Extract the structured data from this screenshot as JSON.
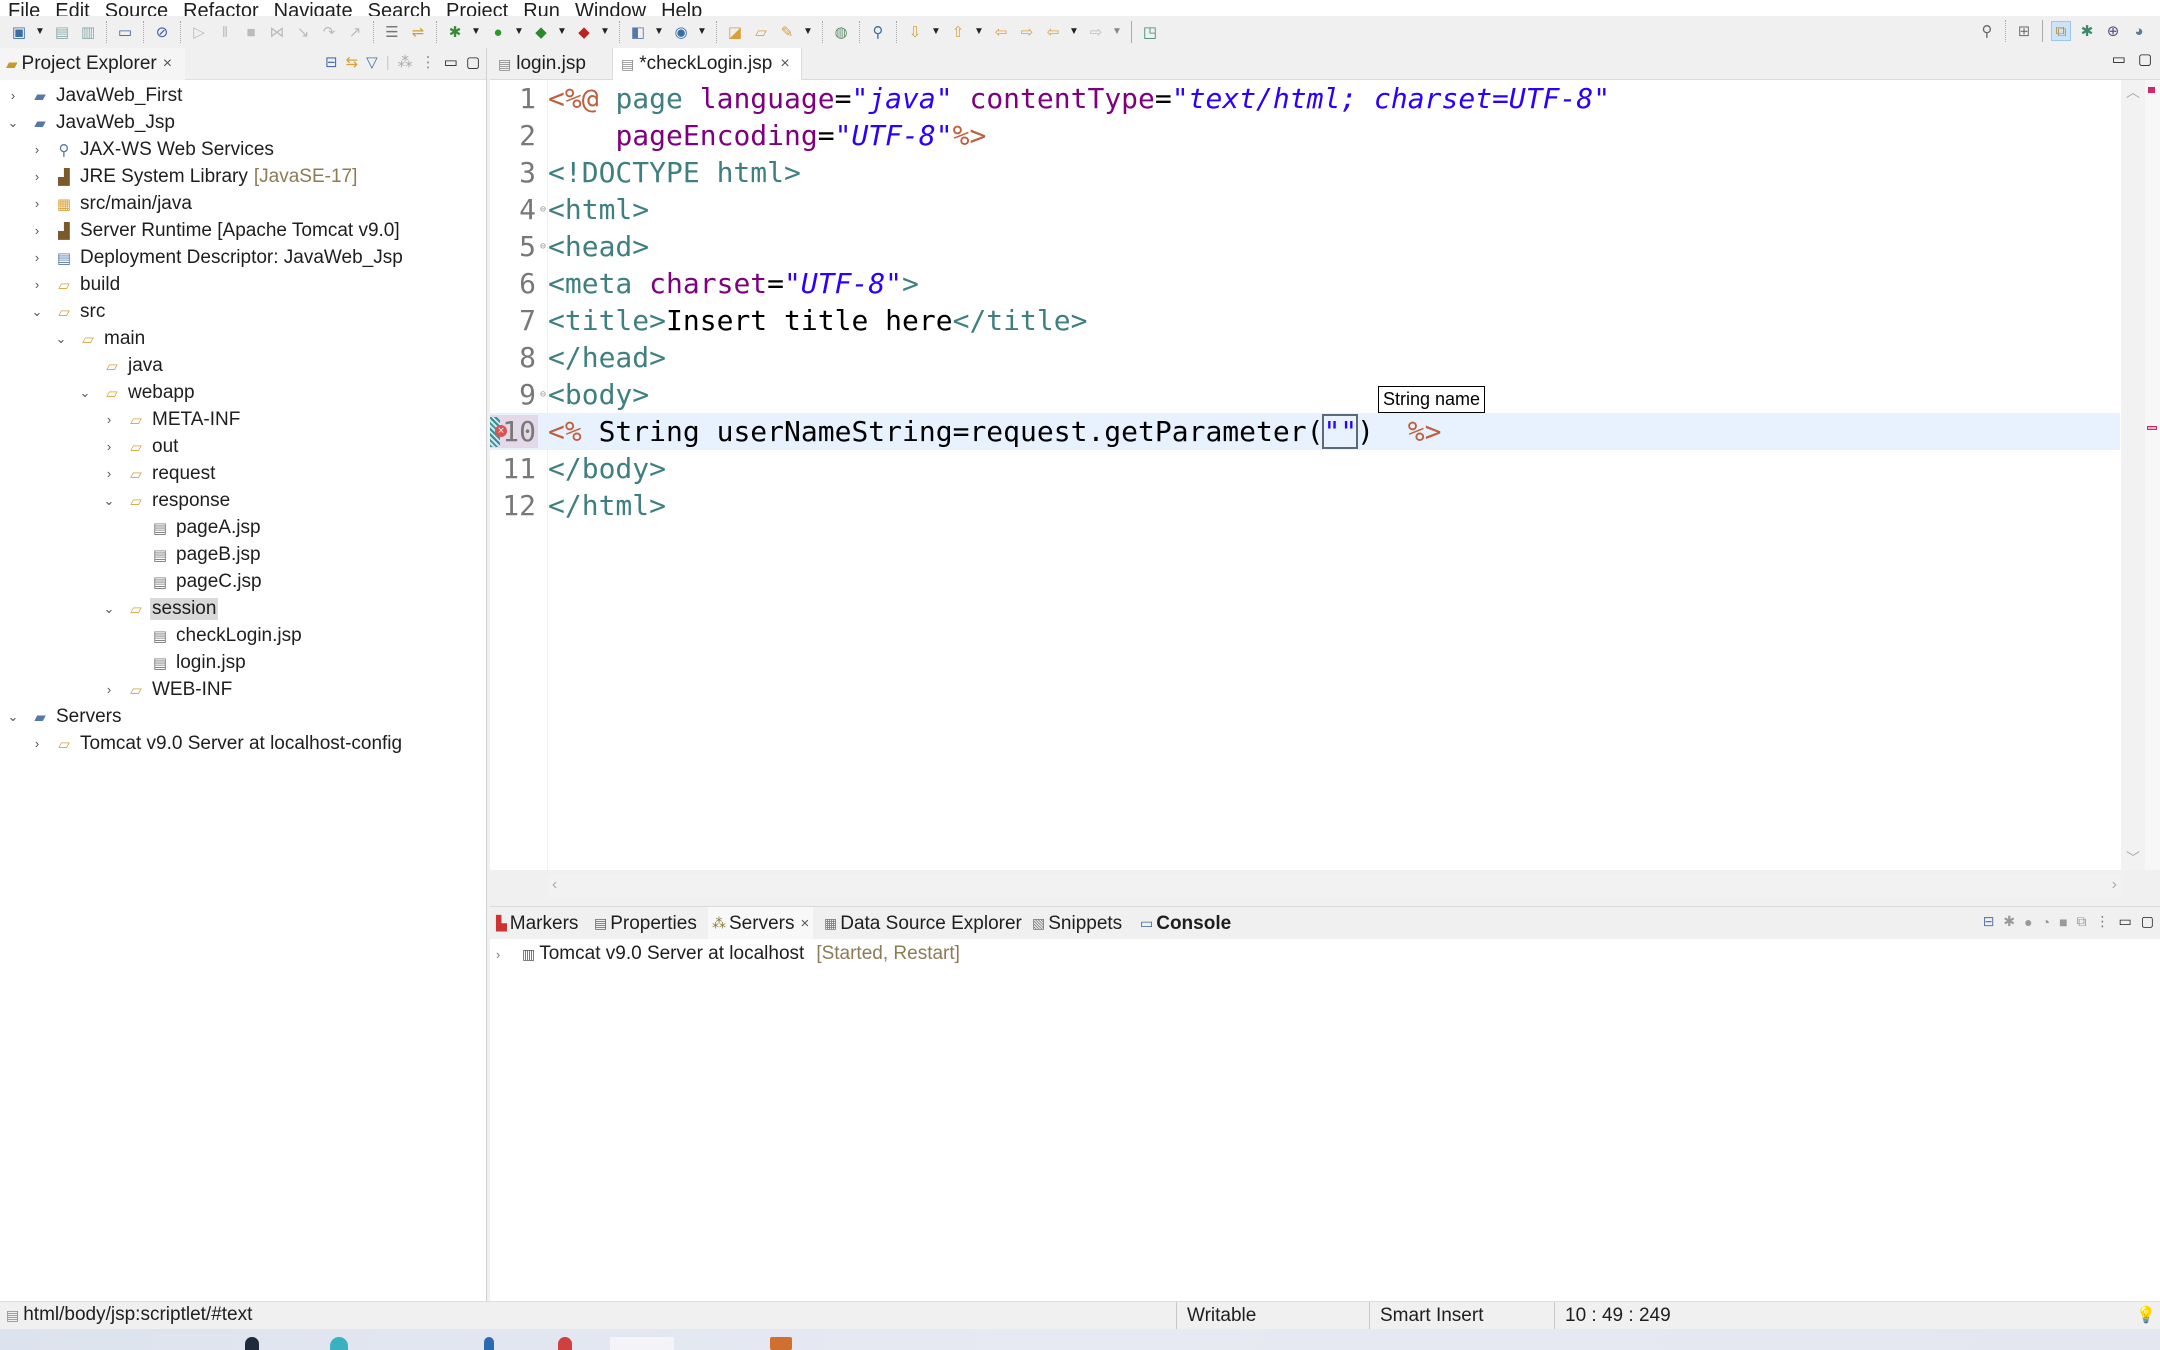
{
  "menu": [
    "File",
    "Edit",
    "Source",
    "Refactor",
    "Navigate",
    "Search",
    "Project",
    "Run",
    "Window",
    "Help"
  ],
  "toolbar": {
    "left_icons": [
      "new-icon",
      "save-icon",
      "save-all-icon",
      "terminal-icon",
      "skip-breakpoints-icon",
      "resume-icon",
      "suspend-icon",
      "terminate-icon",
      "disconnect-icon",
      "step-into-icon",
      "step-over-icon",
      "step-return-icon",
      "drop-to-frame-icon",
      "use-step-filters-icon",
      "debug-icon",
      "run-icon",
      "coverage-icon",
      "external-tools-icon",
      "new-web-service-icon",
      "new-servlet-icon",
      "open-type-icon",
      "open-task-icon",
      "pen-icon",
      "web-browser-icon",
      "run-on-server-icon",
      "next-annotation-icon",
      "previous-annotation-icon",
      "last-edit-icon",
      "back-icon",
      "forward-icon",
      "pin-editor-icon"
    ],
    "right_icons": [
      "search-icon",
      "open-perspective-icon",
      "java-ee-perspective-icon",
      "debug-perspective-icon",
      "java-perspective-icon",
      "web-perspective-icon"
    ]
  },
  "project_explorer": {
    "title": "Project Explorer",
    "tree": [
      {
        "label": "JavaWeb_First",
        "level": 0,
        "expanded": false,
        "icon": "project-icon"
      },
      {
        "label": "JavaWeb_Jsp",
        "level": 0,
        "expanded": true,
        "icon": "project-icon"
      },
      {
        "label": "JAX-WS Web Services",
        "level": 1,
        "expanded": false,
        "icon": "web-services-icon"
      },
      {
        "label": "JRE System Library",
        "decoration": "[JavaSE-17]",
        "level": 1,
        "expanded": false,
        "icon": "library-icon"
      },
      {
        "label": "src/main/java",
        "level": 1,
        "expanded": false,
        "icon": "source-folder-icon"
      },
      {
        "label": "Server Runtime [Apache Tomcat v9.0]",
        "level": 1,
        "expanded": false,
        "icon": "library-icon"
      },
      {
        "label": "Deployment Descriptor: JavaWeb_Jsp",
        "level": 1,
        "expanded": false,
        "icon": "deployment-descriptor-icon"
      },
      {
        "label": "build",
        "level": 1,
        "expanded": false,
        "icon": "folder-icon"
      },
      {
        "label": "src",
        "level": 1,
        "expanded": true,
        "icon": "folder-icon"
      },
      {
        "label": "main",
        "level": 2,
        "expanded": true,
        "icon": "folder-icon"
      },
      {
        "label": "java",
        "level": 3,
        "leaf": true,
        "icon": "folder-icon"
      },
      {
        "label": "webapp",
        "level": 3,
        "expanded": true,
        "icon": "folder-icon"
      },
      {
        "label": "META-INF",
        "level": 4,
        "expanded": false,
        "icon": "folder-icon"
      },
      {
        "label": "out",
        "level": 4,
        "expanded": false,
        "icon": "folder-icon"
      },
      {
        "label": "request",
        "level": 4,
        "expanded": false,
        "icon": "folder-icon"
      },
      {
        "label": "response",
        "level": 4,
        "expanded": true,
        "icon": "folder-icon"
      },
      {
        "label": "pageA.jsp",
        "level": 5,
        "leaf": true,
        "icon": "file-icon"
      },
      {
        "label": "pageB.jsp",
        "level": 5,
        "leaf": true,
        "icon": "file-icon"
      },
      {
        "label": "pageC.jsp",
        "level": 5,
        "leaf": true,
        "icon": "file-icon"
      },
      {
        "label": "session",
        "level": 4,
        "expanded": true,
        "icon": "folder-icon",
        "selected": true
      },
      {
        "label": "checkLogin.jsp",
        "level": 5,
        "leaf": true,
        "icon": "file-icon"
      },
      {
        "label": "login.jsp",
        "level": 5,
        "leaf": true,
        "icon": "file-icon"
      },
      {
        "label": "WEB-INF",
        "level": 4,
        "expanded": false,
        "icon": "folder-icon"
      },
      {
        "label": "Servers",
        "level": 0,
        "expanded": true,
        "icon": "project-icon"
      },
      {
        "label": "Tomcat v9.0 Server at localhost-config",
        "level": 1,
        "expanded": false,
        "icon": "folder-icon"
      }
    ]
  },
  "editor": {
    "tabs": [
      {
        "label": "login.jsp",
        "active": false
      },
      {
        "label": "*checkLogin.jsp",
        "active": true
      }
    ],
    "current_line": 10,
    "lines": [
      {
        "n": "1",
        "fold": false,
        "tokens": [
          [
            "jsp",
            "<%@ "
          ],
          [
            "tag",
            "page "
          ],
          [
            "attr",
            "language"
          ],
          [
            "code",
            "="
          ],
          [
            "val",
            "\"java\" "
          ],
          [
            "attr",
            "contentType"
          ],
          [
            "code",
            "="
          ],
          [
            "val",
            "\"text/html; charset=UTF-8\""
          ]
        ]
      },
      {
        "n": "2",
        "fold": false,
        "tokens": [
          [
            "code",
            "    "
          ],
          [
            "attr",
            "pageEncoding"
          ],
          [
            "code",
            "="
          ],
          [
            "val",
            "\"UTF-8\""
          ],
          [
            "jsp",
            "%>"
          ]
        ]
      },
      {
        "n": "3",
        "fold": false,
        "tokens": [
          [
            "tag",
            "<!DOCTYPE html>"
          ]
        ]
      },
      {
        "n": "4",
        "fold": true,
        "tokens": [
          [
            "tag",
            "<html>"
          ]
        ]
      },
      {
        "n": "5",
        "fold": true,
        "tokens": [
          [
            "tag",
            "<head>"
          ]
        ]
      },
      {
        "n": "6",
        "fold": false,
        "tokens": [
          [
            "tag",
            "<meta "
          ],
          [
            "attr",
            "charset"
          ],
          [
            "code",
            "="
          ],
          [
            "val",
            "\"UTF-8\""
          ],
          [
            "tag",
            ">"
          ]
        ]
      },
      {
        "n": "7",
        "fold": false,
        "tokens": [
          [
            "tag",
            "<title>"
          ],
          [
            "text",
            "Insert title here"
          ],
          [
            "tag",
            "</title>"
          ]
        ]
      },
      {
        "n": "8",
        "fold": false,
        "tokens": [
          [
            "tag",
            "</head>"
          ]
        ]
      },
      {
        "n": "9",
        "fold": true,
        "tokens": [
          [
            "tag",
            "<body>"
          ]
        ]
      },
      {
        "n": "10",
        "fold": false,
        "error": true,
        "tokens": [
          [
            "jsp",
            "<% "
          ],
          [
            "code",
            "String userNameString=request.getParameter("
          ],
          [
            "linked",
            "\"\""
          ],
          [
            "code",
            ")"
          ],
          [
            "code",
            "  "
          ],
          [
            "jsp",
            "%>"
          ]
        ]
      },
      {
        "n": "11",
        "fold": false,
        "tokens": [
          [
            "tag",
            "</body>"
          ]
        ]
      },
      {
        "n": "12",
        "fold": false,
        "tokens": [
          [
            "tag",
            "</html>"
          ]
        ]
      }
    ],
    "tooltip": "String name"
  },
  "bottom_panel": {
    "tabs": [
      {
        "label": "Markers",
        "icon": "markers-icon"
      },
      {
        "label": "Properties",
        "icon": "properties-icon"
      },
      {
        "label": "Servers",
        "icon": "servers-icon",
        "active": true,
        "closable": true
      },
      {
        "label": "Data Source Explorer",
        "icon": "data-source-icon"
      },
      {
        "label": "Snippets",
        "icon": "snippets-icon"
      },
      {
        "label": "Console",
        "icon": "console-icon",
        "bold": true
      }
    ],
    "servers": [
      {
        "name": "Tomcat v9.0 Server at localhost",
        "state": "[Started, Restart]"
      }
    ]
  },
  "statusbar": {
    "path": "html/body/jsp:scriptlet/#text",
    "writable": "Writable",
    "insert_mode": "Smart Insert",
    "position": "10 : 49 : 249"
  },
  "colors": {
    "jsp_delimiter": "#bf5f3f",
    "tag": "#3f7f7f",
    "attribute": "#7f007f",
    "attribute_value": "#2a00ff",
    "current_line": "#e8f2fe",
    "error_overview": "#d1286b"
  }
}
